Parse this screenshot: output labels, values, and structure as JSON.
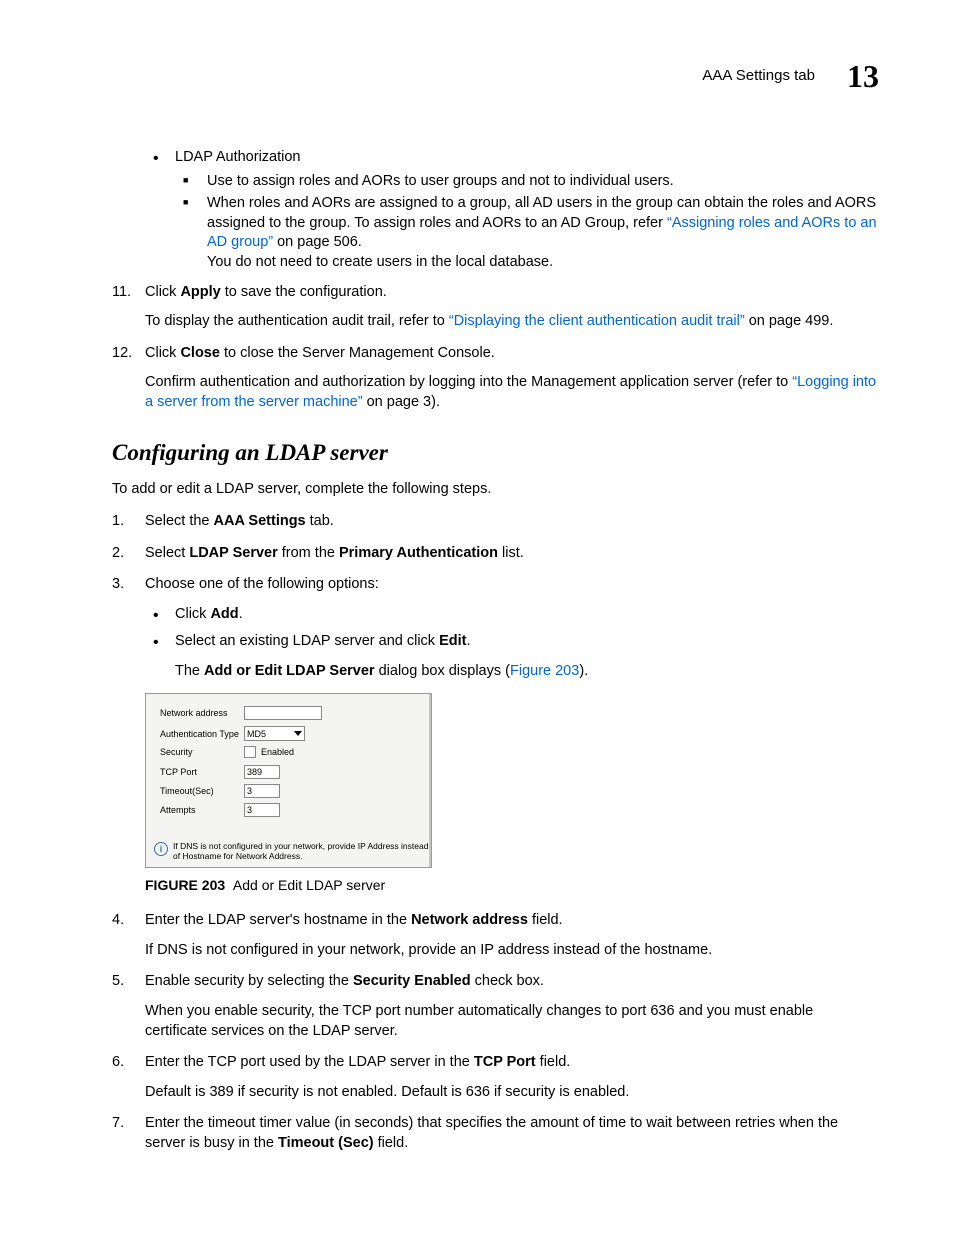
{
  "header": {
    "title": "AAA Settings tab",
    "chapter": "13"
  },
  "top_bullet": {
    "title": "LDAP Authorization",
    "sq1": "Use to assign roles and AORs to user groups and not to individual users.",
    "sq2a": "When roles and AORs are assigned to a group, all AD users in the group can obtain the roles and AORS assigned to the group. To assign roles and AORs to an AD Group, refer ",
    "sq2link": "“Assigning roles and AORs to an AD group”",
    "sq2b": " on page 506.",
    "sq2c": "You do not need to create users in the local database."
  },
  "step11": {
    "num": "11.",
    "a": "Click ",
    "b": "Apply",
    "c": " to save the configuration.",
    "p1a": "To display the authentication audit trail, refer to ",
    "p1link": "“Displaying the client authentication audit trail”",
    "p1b": " on page 499."
  },
  "step12": {
    "num": "12.",
    "a": "Click ",
    "b": "Close",
    "c": " to close the Server Management Console.",
    "p1a": "Confirm authentication and authorization by logging into the Management application server (refer to ",
    "p1link": "“Logging into a server from the server machine”",
    "p1b": " on page 3)."
  },
  "section_title": "Configuring an LDAP server",
  "section_intro": "To add or edit a LDAP server, complete the following steps.",
  "s1": {
    "num": "1.",
    "a": "Select the ",
    "b": "AAA Settings",
    "c": " tab."
  },
  "s2": {
    "num": "2.",
    "a": "Select ",
    "b": "LDAP Server",
    "c": " from the ",
    "d": "Primary Authentication",
    "e": " list."
  },
  "s3": {
    "num": "3.",
    "a": "Choose one of the following options:",
    "opt1a": "Click ",
    "opt1b": "Add",
    "opt1c": ".",
    "opt2a": "Select an existing LDAP server and click ",
    "opt2b": "Edit",
    "opt2c": ".",
    "p1a": "The ",
    "p1b": "Add or Edit LDAP Server",
    "p1c": " dialog box displays (",
    "p1link": "Figure 203",
    "p1d": ")."
  },
  "dialog": {
    "network": "Network address",
    "authtype": "Authentication Type",
    "authtype_val": "MD5",
    "security": "Security",
    "enabled": "Enabled",
    "tcp": "TCP Port",
    "tcp_val": "389",
    "timeout": "Timeout(Sec)",
    "timeout_val": "3",
    "attempts": "Attempts",
    "attempts_val": "3",
    "info_icon": "i",
    "info": "If DNS is not configured in your network, provide IP Address instead of Hostname for Network Address."
  },
  "fig": {
    "num": "FIGURE 203",
    "caption": "Add or Edit LDAP server"
  },
  "s4": {
    "num": "4.",
    "a": "Enter the LDAP server's hostname in the ",
    "b": "Network address",
    "c": " field.",
    "p1": "If DNS is not configured in your network, provide an IP address instead of the hostname."
  },
  "s5": {
    "num": "5.",
    "a": "Enable security by selecting the ",
    "b": "Security Enabled",
    "c": " check box.",
    "p1": "When you enable security, the TCP port number automatically changes to port 636 and you must enable certificate services on the LDAP server."
  },
  "s6": {
    "num": "6.",
    "a": "Enter the TCP port used by the LDAP server in the ",
    "b": "TCP Port",
    "c": " field.",
    "p1": "Default is 389 if security is not enabled. Default is 636 if security is enabled."
  },
  "s7": {
    "num": "7.",
    "a": "Enter the timeout timer value (in seconds) that specifies the amount of time to wait between retries when the server is busy in the ",
    "b": "Timeout (Sec)",
    "c": " field."
  }
}
